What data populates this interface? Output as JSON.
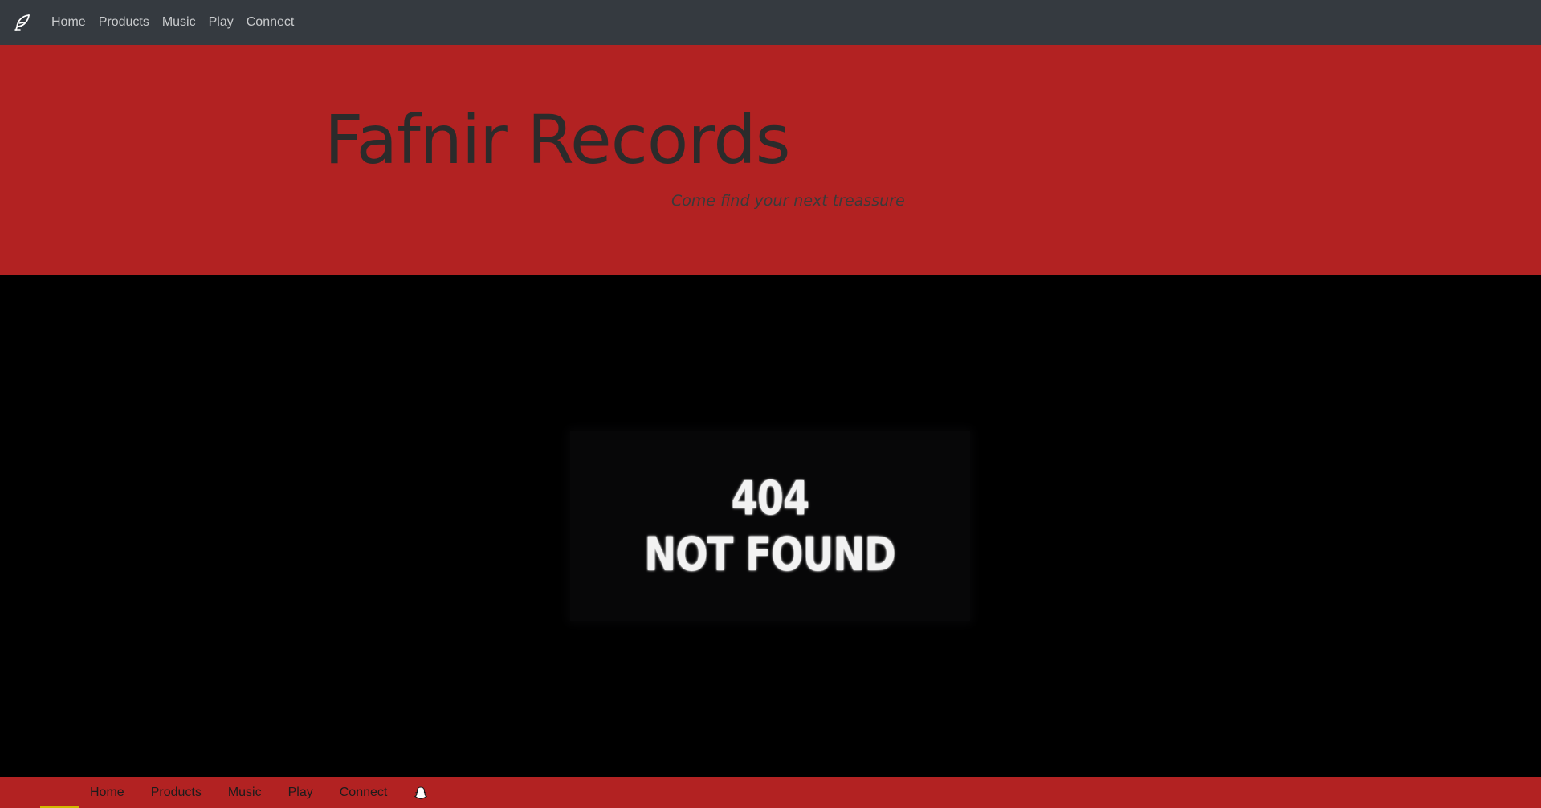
{
  "nav": {
    "brand_icon": "feather-icon",
    "items": [
      {
        "label": "Home"
      },
      {
        "label": "Products"
      },
      {
        "label": "Music"
      },
      {
        "label": "Play"
      },
      {
        "label": "Connect"
      }
    ]
  },
  "hero": {
    "title": "Fafnir Records",
    "tagline": "Come find your next treassure"
  },
  "main": {
    "error_code": "404",
    "error_text": "NOT FOUND"
  },
  "footer": {
    "items": [
      {
        "label": "Home"
      },
      {
        "label": "Products"
      },
      {
        "label": "Music"
      },
      {
        "label": "Play"
      },
      {
        "label": "Connect"
      }
    ],
    "social_icon": "snapchat-ghost-icon"
  },
  "colors": {
    "navbar_bg": "#353a40",
    "brand_red": "#b22222",
    "page_bg": "#000000"
  }
}
